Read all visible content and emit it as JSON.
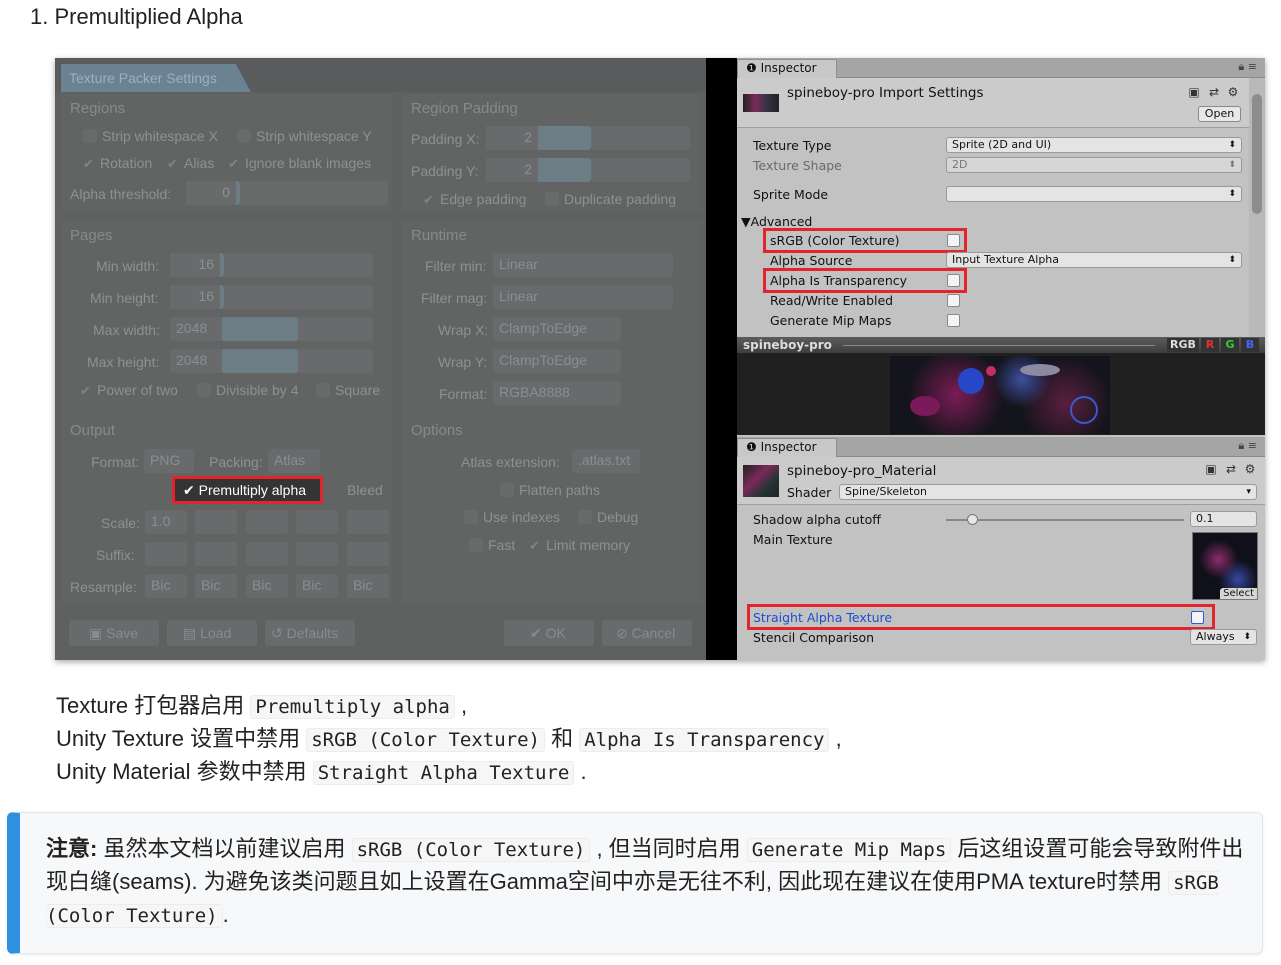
{
  "heading": "1. Premultiplied Alpha",
  "packer": {
    "title": "Texture Packer Settings",
    "regions": {
      "section": "Regions",
      "strip_x": "Strip whitespace X",
      "strip_y": "Strip whitespace Y",
      "rotation": "Rotation",
      "alias": "Alias",
      "ignore_blank": "Ignore blank images",
      "alpha_threshold_label": "Alpha threshold:",
      "alpha_threshold_value": "0"
    },
    "region_padding": {
      "section": "Region Padding",
      "padding_x_label": "Padding X:",
      "padding_x_value": "2",
      "padding_y_label": "Padding Y:",
      "padding_y_value": "2",
      "edge_padding": "Edge padding",
      "duplicate_padding": "Duplicate padding"
    },
    "pages": {
      "section": "Pages",
      "min_width_label": "Min width:",
      "min_width_value": "16",
      "min_height_label": "Min height:",
      "min_height_value": "16",
      "max_width_label": "Max width:",
      "max_width_value": "2048",
      "max_height_label": "Max height:",
      "max_height_value": "2048",
      "power_of_two": "Power of two",
      "divisible_by_4": "Divisible by 4",
      "square": "Square"
    },
    "runtime": {
      "section": "Runtime",
      "filter_min_label": "Filter min:",
      "filter_min_value": "Linear",
      "filter_mag_label": "Filter mag:",
      "filter_mag_value": "Linear",
      "wrap_x_label": "Wrap X:",
      "wrap_x_value": "ClampToEdge",
      "wrap_y_label": "Wrap Y:",
      "wrap_y_value": "ClampToEdge",
      "format_label": "Format:",
      "format_value": "RGBA8888"
    },
    "output": {
      "section": "Output",
      "format_label": "Format:",
      "format_value": "PNG",
      "packing_label": "Packing:",
      "packing_value": "Atlas",
      "premultiply": "Premultiply alpha",
      "bleed": "Bleed",
      "scale_label": "Scale:",
      "scale_value": "1.0",
      "suffix_label": "Suffix:",
      "resample_label": "Resample:",
      "resample_values": [
        "Bic",
        "Bic",
        "Bic",
        "Bic",
        "Bic"
      ]
    },
    "options": {
      "section": "Options",
      "atlas_ext_label": "Atlas extension:",
      "atlas_ext_value": ".atlas.txt",
      "flatten_paths": "Flatten paths",
      "use_indexes": "Use indexes",
      "debug": "Debug",
      "fast": "Fast",
      "limit_memory": "Limit memory"
    },
    "buttons": {
      "save": "Save",
      "load": "Load",
      "defaults": "Defaults",
      "ok": "OK",
      "cancel": "Cancel"
    }
  },
  "inspector1": {
    "tab": "Inspector",
    "title": "spineboy-pro Import Settings",
    "open": "Open",
    "texture_type_label": "Texture Type",
    "texture_type_value": "Sprite (2D and UI)",
    "texture_shape_label": "Texture Shape",
    "texture_shape_value": "2D",
    "sprite_mode_label": "Sprite Mode",
    "sprite_mode_value": "",
    "advanced_label": "Advanced",
    "srgb_label": "sRGB (Color Texture)",
    "alpha_source_label": "Alpha Source",
    "alpha_source_value": "Input Texture Alpha",
    "alpha_transparency_label": "Alpha Is Transparency",
    "read_write_label": "Read/Write Enabled",
    "gen_mips_label": "Generate Mip Maps",
    "preview_title": "spineboy-pro",
    "channels": [
      "RGB",
      "R",
      "G",
      "B"
    ]
  },
  "inspector2": {
    "tab": "Inspector",
    "title": "spineboy-pro_Material",
    "shader_label": "Shader",
    "shader_value": "Spine/Skeleton",
    "shadow_cutoff_label": "Shadow alpha cutoff",
    "shadow_cutoff_value": "0.1",
    "main_texture_label": "Main Texture",
    "select": "Select",
    "straight_alpha_label": "Straight Alpha Texture",
    "stencil_label": "Stencil Comparison",
    "stencil_value": "Always"
  },
  "body": {
    "line1_pre": "Texture 打包器启用 ",
    "line1_code": "Premultiply alpha",
    "line1_post": " ,",
    "line2_pre": "Unity Texture 设置中禁用 ",
    "line2_code1": "sRGB (Color Texture)",
    "line2_mid": " 和 ",
    "line2_code2": "Alpha Is Transparency",
    "line2_post": " ,",
    "line3_pre": "Unity Material 参数中禁用 ",
    "line3_code": "Straight Alpha Texture",
    "line3_post": " ."
  },
  "note": {
    "label": "注意:",
    "t1": " 虽然本文档以前建议启用 ",
    "code1": "sRGB (Color Texture)",
    "t2": " , 但当同时启用 ",
    "code2": "Generate Mip Maps",
    "t3": " 后这组设置可能会导致附件出现白缝(seams). 为避免该类问题且如上设置在Gamma空间中亦是无往不利, 因此现在建议在使用PMA texture时禁用 ",
    "code3": "sRGB (Color Texture)",
    "t4": "."
  },
  "colors": {
    "highlight_red": "#e0262c",
    "note_accent": "#2f8fe0"
  }
}
